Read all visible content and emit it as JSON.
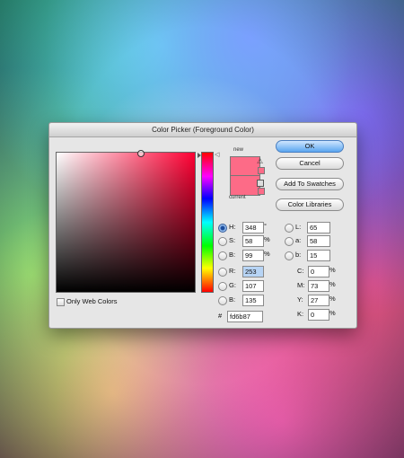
{
  "dialog": {
    "title": "Color Picker (Foreground Color)",
    "new_label": "new",
    "current_label": "current",
    "new_color": "#fd6b87",
    "current_color": "#fd6b87",
    "only_web_colors_label": "Only Web Colors",
    "only_web_colors_checked": false,
    "selected_mode": "H"
  },
  "buttons": {
    "ok": "OK",
    "cancel": "Cancel",
    "add_to_swatches": "Add To Swatches",
    "color_libraries": "Color Libraries"
  },
  "hsb": {
    "h_label": "H:",
    "h_value": "348",
    "h_unit": "°",
    "s_label": "S:",
    "s_value": "58",
    "s_unit": "%",
    "b_label": "B:",
    "b_value": "99",
    "b_unit": "%"
  },
  "lab": {
    "l_label": "L:",
    "l_value": "65",
    "a_label": "a:",
    "a_value": "58",
    "b_label": "b:",
    "b_value": "15"
  },
  "rgb": {
    "r_label": "R:",
    "r_value": "253",
    "g_label": "G:",
    "g_value": "107",
    "b_label": "B:",
    "b_value": "135"
  },
  "cmyk": {
    "c_label": "C:",
    "c_value": "0",
    "c_unit": "%",
    "m_label": "M:",
    "m_value": "73",
    "m_unit": "%",
    "y_label": "Y:",
    "y_value": "27",
    "y_unit": "%",
    "k_label": "K:",
    "k_value": "0",
    "k_unit": "%"
  },
  "hex": {
    "label": "#",
    "value": "fd6b87"
  }
}
